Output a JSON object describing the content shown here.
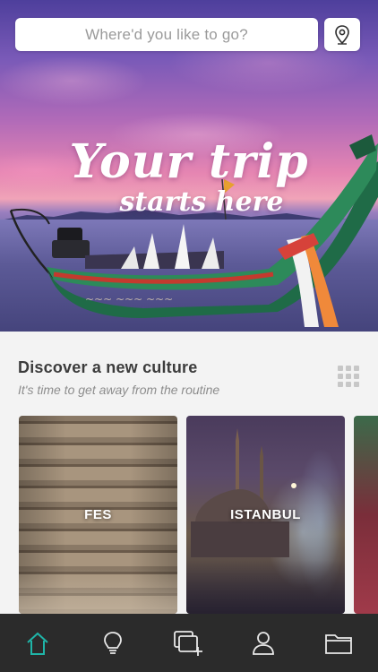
{
  "search": {
    "placeholder": "Where'd you like to go?",
    "location_icon": "location-pin-icon"
  },
  "hero": {
    "line1": "Your trip",
    "line2": "starts here"
  },
  "section": {
    "title": "Discover a new culture",
    "subtitle": "It's time to get away from the routine",
    "grid_icon": "grid-icon"
  },
  "cards": [
    {
      "label": "FES"
    },
    {
      "label": "ISTANBUL"
    },
    {
      "label": ""
    }
  ],
  "tabbar": {
    "active_color": "#1fb5a8",
    "inactive_color": "#e8e8e8",
    "tabs": [
      {
        "icon": "home-icon",
        "active": true
      },
      {
        "icon": "lightbulb-icon",
        "active": false
      },
      {
        "icon": "add-collection-icon",
        "active": false
      },
      {
        "icon": "profile-icon",
        "active": false
      },
      {
        "icon": "folder-icon",
        "active": false
      }
    ]
  }
}
